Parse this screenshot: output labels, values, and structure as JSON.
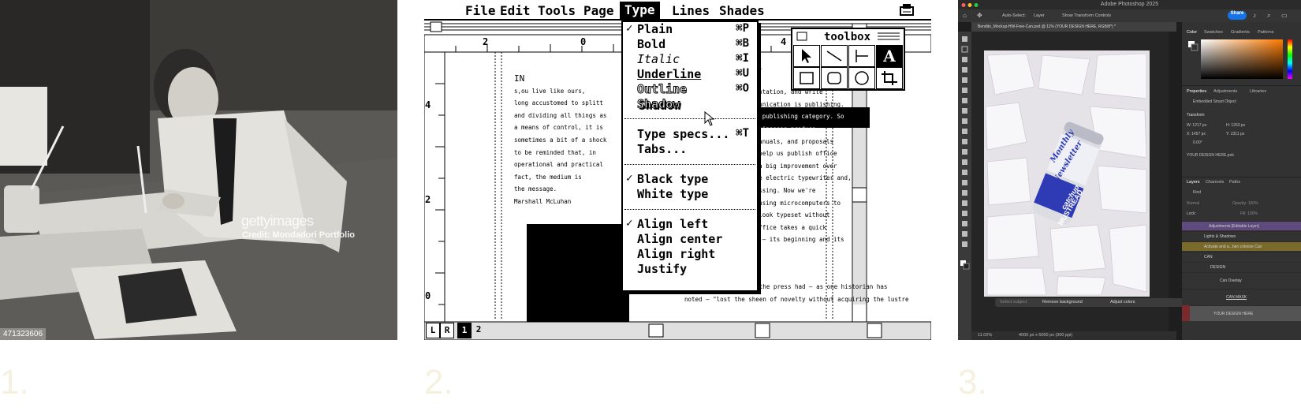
{
  "panels": {
    "one": {
      "number": "1.",
      "watermark_logo": "gettyimages",
      "credit": "Credit: Mondadori Portfolio",
      "photo_id": "471323606"
    },
    "two": {
      "number": "2.",
      "menubar": {
        "apple": "",
        "items": [
          "File",
          "Edit",
          "Tools",
          "Page",
          "Type",
          "Lines",
          "Shades"
        ],
        "selected": "Type"
      },
      "type_menu": {
        "group1": [
          {
            "label": "Plain",
            "key": "⌘P",
            "checked": true
          },
          {
            "label": "Bold",
            "key": "⌘B",
            "checked": false
          },
          {
            "label": "Italic",
            "key": "⌘I",
            "checked": false
          },
          {
            "label": "Underline",
            "key": "⌘U",
            "checked": false
          },
          {
            "label": "Outline",
            "key": "⌘O",
            "checked": false
          },
          {
            "label": "Shadow",
            "key": "",
            "checked": false
          }
        ],
        "group2": [
          {
            "label": "Type specs...",
            "key": "⌘T"
          },
          {
            "label": "Tabs...",
            "key": ""
          }
        ],
        "group3": [
          {
            "label": "Black type",
            "checked": true
          },
          {
            "label": "White type",
            "checked": false
          }
        ],
        "group4": [
          {
            "label": "Align left",
            "checked": true
          },
          {
            "label": "Align center",
            "checked": false
          },
          {
            "label": "Align right",
            "checked": false
          },
          {
            "label": "Justify",
            "checked": false
          }
        ]
      },
      "toolbox": {
        "title": "toolbox",
        "text_tool": "A"
      },
      "ruler": {
        "top": [
          "2",
          "0",
          "4"
        ],
        "left": [
          "4",
          "2",
          "0"
        ]
      },
      "page_tabs": [
        "L",
        "R",
        "1",
        "2"
      ],
      "column_left": [
        "IN",
        "s,ou live like ours,",
        "long accustomed to splitt",
        "and dividing all things as",
        "a means of control, it is",
        "sometimes a bit of a shock",
        "to be reminded that, in",
        "operational and practical",
        "fact, the medium is",
        "the message.",
        "",
        "Marshall McLuhan"
      ],
      "column_right": [
        "blishing busi",
        "you publish",
        "gore a presentation, and write",
        "written communication is publishing.",
        "all into the publishing category. So",
        "uals that businesses produce —",
        "brochures, manuals, and proposals",
        "ew tools to help us publish office",
        "ewriter was a big improvement over",
        "llowed by the electric typewriter and,",
        "y word processing. Now we're",
        "publishing, using microcomputers to",
        "uments that look typeset without",
        "",
        "Tomorrow's Office takes a quick",
        "ry and today — its beginning and its"
      ],
      "column_bottom": [
        "By the 15th century, the press had — as one historian has",
        "noted — \"lost the sheen of novelty without acquiring the lustre"
      ]
    },
    "three": {
      "number": "3.",
      "app_title": "Adobe Photoshop 2025",
      "options": {
        "auto_select": "Auto-Select:",
        "layer": "Layer",
        "show_transform": "Show Transform Controls",
        "share": "Share"
      },
      "doc_tab": "Bendito_Mockup-HW-Free-Can.psd @ 11% (YOUR DESIGN HERE, RGB/8*) *",
      "can_text": {
        "line1": "Monthly",
        "line2": "Newsletter",
        "line3": "catchup",
        "line4": "MUSTREAD"
      },
      "context_bar": [
        "Select subject",
        "Remove background",
        "Adjust colors"
      ],
      "status": {
        "zoom": "11.02%",
        "size": "4000 px x 6000 px (300 ppi)"
      },
      "color_tabs": [
        "Color",
        "Swatches",
        "Gradients",
        "Patterns"
      ],
      "properties_tabs": [
        "Properties",
        "Adjustments",
        "Libraries"
      ],
      "properties": {
        "kind": "Embedded Smart Object",
        "transform": "Transform",
        "w": "W: 1217 px",
        "h": "H: 1263 px",
        "x": "X: 1457 px",
        "y": "Y: 2311 px",
        "angle": "0.00°",
        "file": "YOUR DESIGN HERE.psb"
      },
      "layers_tabs": [
        "Layers",
        "Channels",
        "Paths"
      ],
      "layers_search": "Kind",
      "blend": "Normal",
      "opacity": "Opacity: 100%",
      "lock": "Lock:",
      "fill": "Fill: 100%",
      "layers": [
        {
          "name": "Adjustments [Editable Layer]",
          "color": "#5e4a7c"
        },
        {
          "name": "Lights & Shadows",
          "color": ""
        },
        {
          "name": "Activate and a...hen colorize Can",
          "color": "#7a6a2a"
        },
        {
          "name": "CAN",
          "color": ""
        },
        {
          "name": "DESIGN",
          "color": ""
        },
        {
          "name": "Can Overlay",
          "color": ""
        },
        {
          "name": "CAN MASK",
          "color": ""
        },
        {
          "name": "YOUR DESIGN HERE",
          "color": "#7a2a2a"
        }
      ],
      "colors": {
        "accent": "#1473e6",
        "panel": "#323232"
      }
    }
  }
}
